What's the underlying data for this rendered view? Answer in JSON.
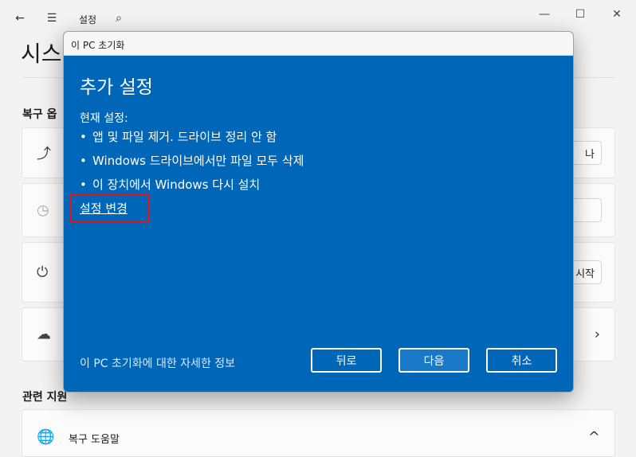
{
  "background": {
    "nav": {
      "back_icon": "←",
      "menu_icon": "☰",
      "app_title": "설정",
      "search_icon": "⌕"
    },
    "window_controls": {
      "minimize": "—",
      "maximize": "☐",
      "close": "✕"
    },
    "page_title": "시스",
    "section_recovery": "복구 옵",
    "cards": [
      {
        "icon": "⤴",
        "button_label": "나"
      },
      {
        "icon": "◷",
        "button_label": ""
      },
      {
        "icon": "⏻",
        "button_label": "시작"
      },
      {
        "icon": "☁",
        "chevron": "›"
      }
    ],
    "section_related": "관련 지원",
    "help_label": "복구 도움말",
    "help_chevron": "^"
  },
  "dialog": {
    "title": "이 PC 초기화",
    "heading": "추가 설정",
    "current_settings_label": "현재 설정:",
    "items": [
      "앱 및 파일 제거. 드라이브 정리 안 함",
      "Windows 드라이브에서만 파일 모두 삭제",
      "이 장치에서 Windows 다시 설치"
    ],
    "change_settings_link": "설정 변경",
    "info_link": "이 PC 초기화에 대한 자세한 정보",
    "buttons": {
      "back": "뒤로",
      "next": "다음",
      "cancel": "취소"
    }
  },
  "colors": {
    "dialog_bg": "#0067b8",
    "highlight": "#e11111"
  }
}
